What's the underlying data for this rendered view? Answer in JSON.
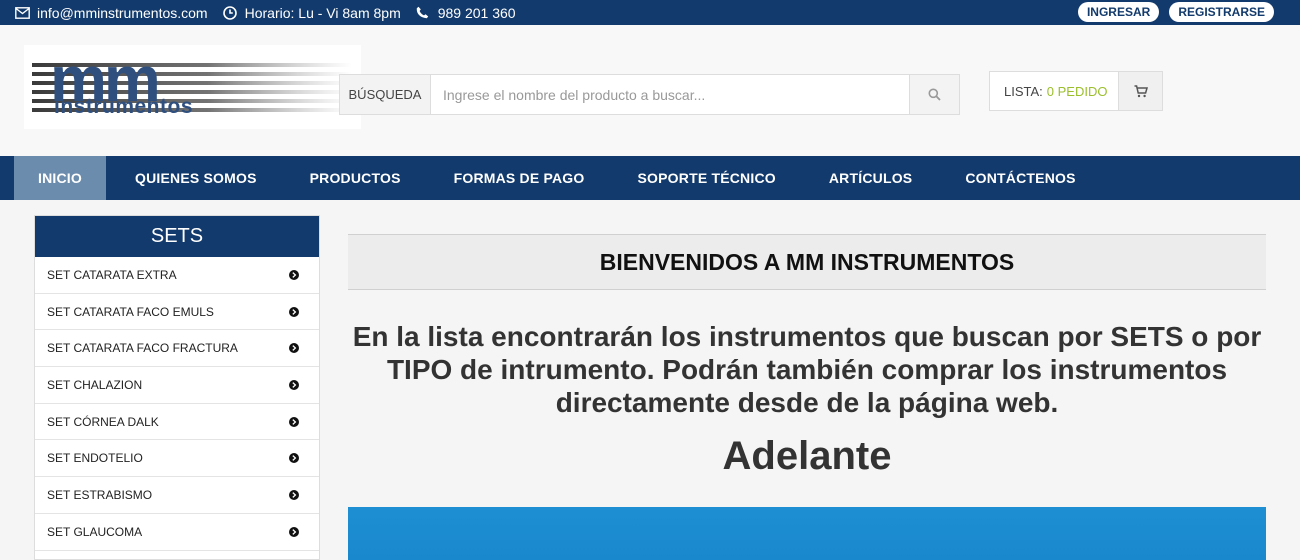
{
  "topbar": {
    "email": "info@mminstrumentos.com",
    "hours": "Horario: Lu - Vi 8am 8pm",
    "phone": "989 201 360",
    "login": "INGRESAR",
    "register": "REGISTRARSE"
  },
  "logo": {
    "mm": "mm",
    "sub": "instrumentos"
  },
  "search": {
    "label": "BÚSQUEDA",
    "placeholder": "Ingrese el nombre del producto a buscar..."
  },
  "cart": {
    "label": "LISTA:",
    "count": "0 PEDIDO"
  },
  "nav": [
    {
      "label": "INICIO"
    },
    {
      "label": "QUIENES SOMOS"
    },
    {
      "label": "PRODUCTOS"
    },
    {
      "label": "FORMAS DE PAGO"
    },
    {
      "label": "SOPORTE TÉCNICO"
    },
    {
      "label": "ARTÍCULOS"
    },
    {
      "label": "CONTÁCTENOS"
    }
  ],
  "sidebar": {
    "title": "SETS",
    "items": [
      {
        "label": "SET CATARATA EXTRA"
      },
      {
        "label": "SET CATARATA FACO EMULS"
      },
      {
        "label": "SET CATARATA FACO FRACTURA"
      },
      {
        "label": "SET CHALAZION"
      },
      {
        "label": "SET CÓRNEA DALK"
      },
      {
        "label": "SET ENDOTELIO"
      },
      {
        "label": "SET ESTRABISMO"
      },
      {
        "label": "SET GLAUCOMA"
      }
    ]
  },
  "main": {
    "welcome": "BIENVENIDOS A MM INSTRUMENTOS",
    "intro": "En la lista encontrarán los instrumentos que buscan por SETS o por TIPO de intrumento. Podrán también comprar los instrumentos directamente desde de la página web.",
    "cta": "Adelante"
  },
  "colors": {
    "brand": "#123a6c",
    "nav_active": "#6c8cad",
    "cart_count": "#9bbf2c",
    "banner": "#1e8fd3"
  }
}
